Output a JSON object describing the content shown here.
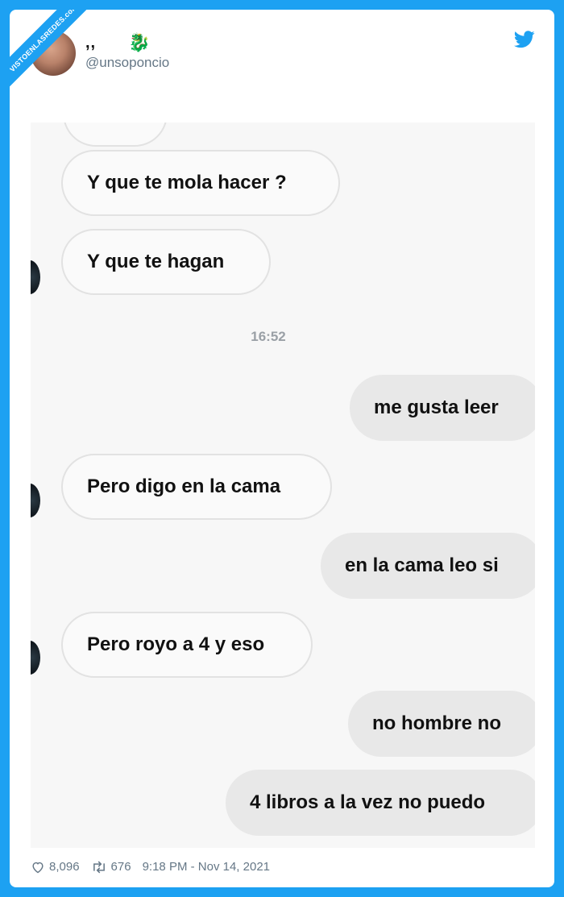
{
  "watermark": "VISTOENLASREDES.com",
  "user": {
    "name": ",,",
    "handle": "@unsoponcio"
  },
  "chat": {
    "messages": [
      {
        "side": "in",
        "text": "Y que te mola hacer ?"
      },
      {
        "side": "in",
        "text": "Y que te hagan"
      },
      {
        "side": "out",
        "text": "me gusta leer"
      },
      {
        "side": "in",
        "text": "Pero digo en la cama"
      },
      {
        "side": "out",
        "text": "en la cama leo si"
      },
      {
        "side": "in",
        "text": "Pero royo a 4 y eso"
      },
      {
        "side": "out",
        "text": "no hombre no"
      },
      {
        "side": "out",
        "text": "4 libros a la vez no puedo"
      }
    ],
    "timestamp": "16:52"
  },
  "footer": {
    "likes": "8,096",
    "retweets": "676",
    "datetime": "9:18 PM - Nov 14, 2021"
  },
  "colors": {
    "twitter_blue": "#1da1f2",
    "incoming_bg": "#fafafa",
    "outgoing_bg": "#e8e8e8"
  },
  "icons": [
    "twitter-bird-icon",
    "heart-icon",
    "retweet-icon",
    "dragon-emoji-icon"
  ]
}
